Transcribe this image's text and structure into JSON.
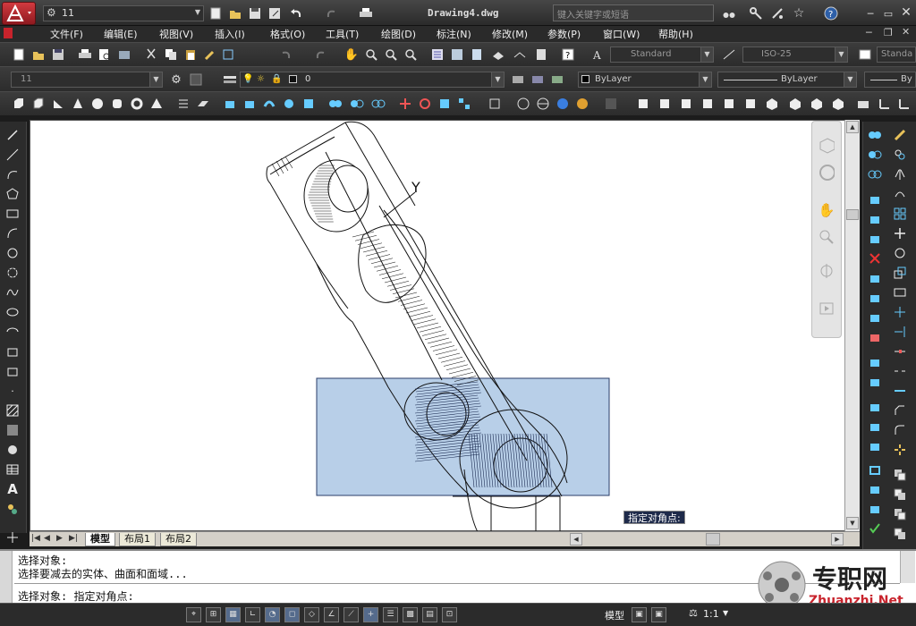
{
  "titlebar": {
    "workspace": "11",
    "file_name": "Drawing4.dwg",
    "search_placeholder": "键入关键字或短语"
  },
  "menu": [
    "文件(F)",
    "编辑(E)",
    "视图(V)",
    "插入(I)",
    "格式(O)",
    "工具(T)",
    "绘图(D)",
    "标注(N)",
    "修改(M)",
    "参数(P)",
    "窗口(W)",
    "帮助(H)"
  ],
  "toolbar1": {
    "text_style": "Standard",
    "dim_style": "ISO-25",
    "table_style": "Standa"
  },
  "toolbar2": {
    "workspace_combo": "11",
    "layer_combo": "0",
    "color_combo": "ByLayer",
    "linetype_combo": "ByLayer",
    "lineweight_combo": "By"
  },
  "canvas": {
    "ucs_label": "Y",
    "tooltip": "指定对角点:"
  },
  "tabs": [
    "模型",
    "布局1",
    "布局2"
  ],
  "command": {
    "line1": "选择对象:",
    "line2": "选择要减去的实体、曲面和面域...",
    "line3": "选择对象: 指定对角点:"
  },
  "status": {
    "model_label": "模型",
    "scale": "1:1"
  },
  "watermark": {
    "cn": "专职网",
    "url": "Zhuanzhi.Net"
  },
  "colors": {
    "accent_red": "#c8232c",
    "selection_fill": "#b8cfe8",
    "selection_stroke": "#2a3d6a"
  }
}
